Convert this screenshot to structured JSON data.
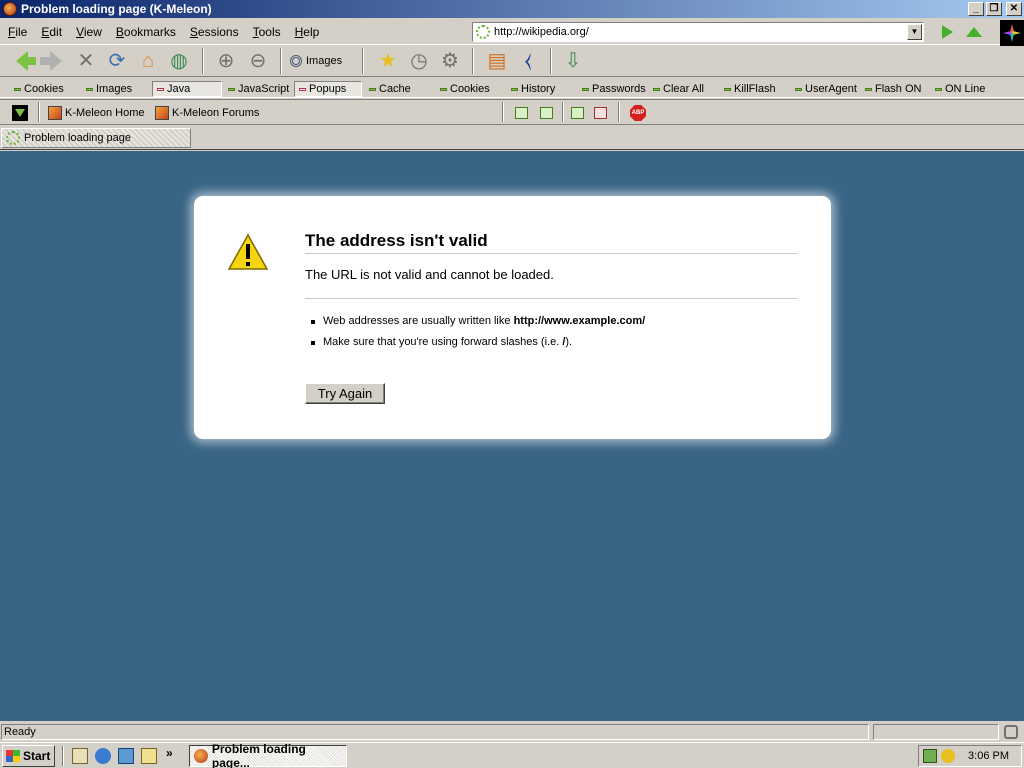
{
  "window": {
    "title": "Problem loading page (K-Meleon)"
  },
  "menu": [
    "File",
    "Edit",
    "View",
    "Bookmarks",
    "Sessions",
    "Tools",
    "Help"
  ],
  "address": {
    "value": "http://wikipedia.org/"
  },
  "navbar": {
    "images_label": "Images"
  },
  "toggles": [
    {
      "label": "Cookies",
      "state": "on"
    },
    {
      "label": "Images",
      "state": "on"
    },
    {
      "label": "Java",
      "state": "off"
    },
    {
      "label": "JavaScript",
      "state": "on"
    },
    {
      "label": "Popups",
      "state": "off"
    },
    {
      "label": "Cache",
      "state": "on"
    },
    {
      "label": "Cookies",
      "state": "on"
    },
    {
      "label": "History",
      "state": "on"
    },
    {
      "label": "Passwords",
      "state": "on"
    },
    {
      "label": "Clear All",
      "state": "on"
    },
    {
      "label": "KillFlash",
      "state": "on"
    },
    {
      "label": "UserAgent",
      "state": "on"
    },
    {
      "label": "Flash ON",
      "state": "on"
    },
    {
      "label": "ON Line",
      "state": "on"
    }
  ],
  "bookmarks": [
    "K-Meleon Home",
    "K-Meleon Forums"
  ],
  "adblock_icon": "ABP",
  "tab": {
    "label": "Problem loading page"
  },
  "error": {
    "title": "The address isn't valid",
    "description": "The URL is not valid and cannot be loaded.",
    "bullet1_text": "Web addresses are usually written like ",
    "bullet1_bold": "http://www.example.com/",
    "bullet2_text": "Make sure that you're using forward slashes (i.e. ",
    "bullet2_bold": "/",
    "bullet2_end": ").",
    "button": "Try Again"
  },
  "status": {
    "text": "Ready"
  },
  "taskbar": {
    "start_label": "Start",
    "overflow": "»",
    "task_label": "Problem loading page...",
    "clock": "3:06 PM"
  },
  "colors": {
    "content_bg": "#386486",
    "titlebar": "#0a246a",
    "accent_green": "#7cc242"
  }
}
